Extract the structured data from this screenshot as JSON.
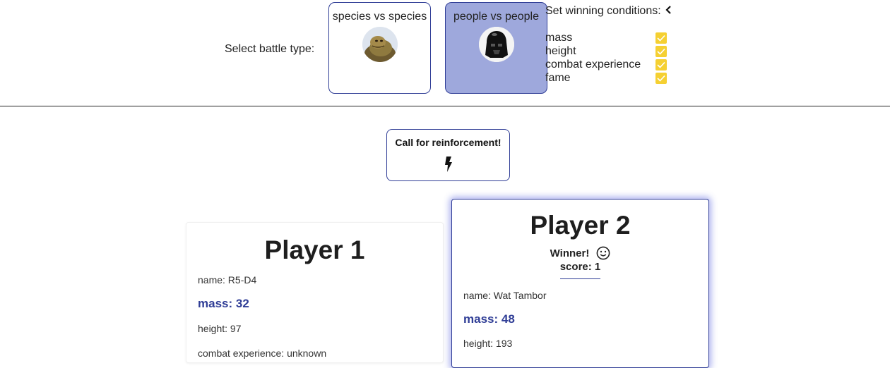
{
  "battle": {
    "select_label": "Select battle type:",
    "options": [
      {
        "label": "species vs species",
        "icon": "jabba-avatar-icon",
        "selected": false
      },
      {
        "label": "people vs people",
        "icon": "darth-vader-avatar-icon",
        "selected": true
      }
    ]
  },
  "conditions": {
    "title": "Set winning conditions:",
    "items": [
      {
        "label": "mass",
        "checked": true
      },
      {
        "label": "height",
        "checked": true
      },
      {
        "label": "combat experience",
        "checked": true
      },
      {
        "label": "fame",
        "checked": true
      }
    ]
  },
  "reinforce": {
    "label": "Call for reinforcement!",
    "icon": "lightning-bolt-icon"
  },
  "players": [
    {
      "title": "Player 1",
      "stats": {
        "name": "name: R5-D4",
        "mass": "mass: 32",
        "height": "height: 97",
        "combat": "combat experience: unknown"
      }
    },
    {
      "title": "Player 2",
      "winner": "Winner!",
      "score": "score: 1",
      "stats": {
        "name": "name: Wat Tambor",
        "mass": "mass: 48",
        "height": "height: 193"
      }
    }
  ],
  "colors": {
    "accent": "#2f3d96",
    "selected_bg": "#9ea8dc",
    "checkbox": "#f5d032"
  }
}
